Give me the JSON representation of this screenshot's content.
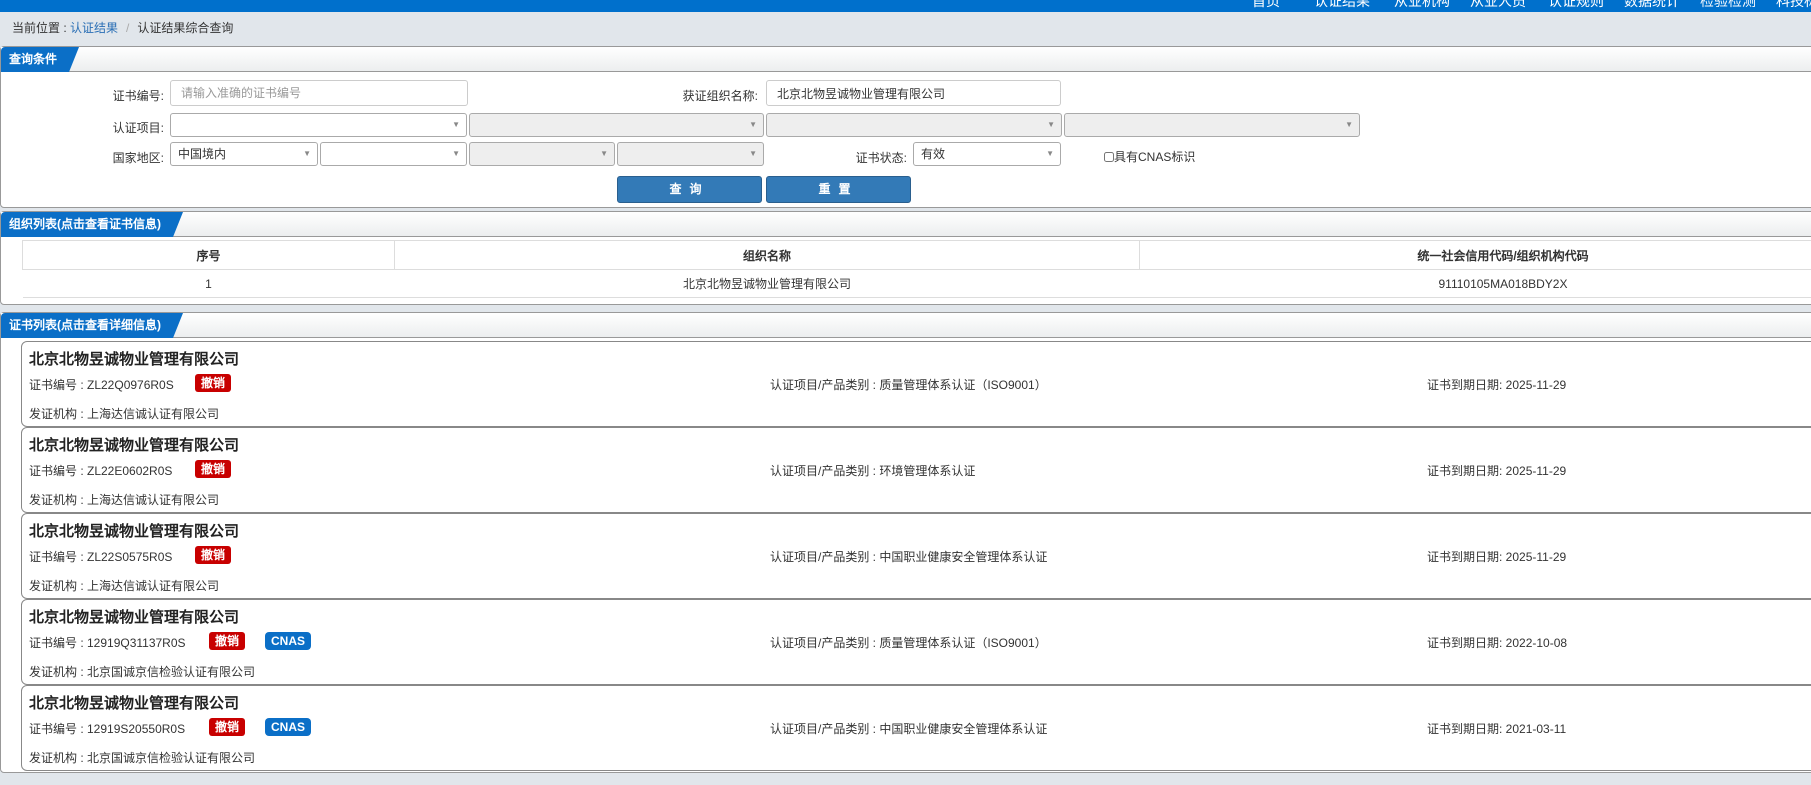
{
  "nav": [
    "首页",
    "认证结果",
    "从业机构",
    "从业人员",
    "认证规则",
    "数据统计",
    "检验检测",
    "科技标准"
  ],
  "breadcrumb": {
    "prefix": "当前位置 : ",
    "link": "认证结果",
    "sep": "/",
    "current": "认证结果综合查询"
  },
  "query": {
    "title": "查询条件",
    "cert_no_label": "证书编号:",
    "cert_no_placeholder": "请输入准确的证书编号",
    "org_label": "获证组织名称:",
    "org_value": "北京北物昱诚物业管理有限公司",
    "item_label": "认证项目:",
    "region_label": "国家地区:",
    "region_value": "中国境内",
    "status_label": "证书状态:",
    "status_value": "有效",
    "cnas_label": "具有CNAS标识",
    "search": "查询",
    "reset": "重置"
  },
  "orgs": {
    "title": "组织列表(点击查看证书信息)",
    "headers": [
      "序号",
      "组织名称",
      "统一社会信用代码/组织机构代码"
    ],
    "rows": [
      [
        "1",
        "北京北物昱诚物业管理有限公司",
        "91110105MA018BDY2X"
      ]
    ]
  },
  "certs": {
    "title": "证书列表(点击查看详细信息)",
    "badge_revoked": "撤销",
    "badge_cnas": "CNAS",
    "items": [
      {
        "org": "北京北物昱诚物业管理有限公司",
        "cert_no": "证书编号 : ZL22Q0976R0S",
        "cnas": false,
        "item": "认证项目/产品类别 : 质量管理体系认证（ISO9001）",
        "issuer": "发证机构 : 上海达信诚认证有限公司",
        "expiry": "证书到期日期: 2025-11-29"
      },
      {
        "org": "北京北物昱诚物业管理有限公司",
        "cert_no": "证书编号 : ZL22E0602R0S",
        "cnas": false,
        "item": "认证项目/产品类别 : 环境管理体系认证",
        "issuer": "发证机构 : 上海达信诚认证有限公司",
        "expiry": "证书到期日期: 2025-11-29"
      },
      {
        "org": "北京北物昱诚物业管理有限公司",
        "cert_no": "证书编号 : ZL22S0575R0S",
        "cnas": false,
        "item": "认证项目/产品类别 : 中国职业健康安全管理体系认证",
        "issuer": "发证机构 : 上海达信诚认证有限公司",
        "expiry": "证书到期日期: 2025-11-29"
      },
      {
        "org": "北京北物昱诚物业管理有限公司",
        "cert_no": "证书编号 : 12919Q31137R0S",
        "cnas": true,
        "item": "认证项目/产品类别 : 质量管理体系认证（ISO9001）",
        "issuer": "发证机构 : 北京国诚京信检验认证有限公司",
        "expiry": "证书到期日期: 2022-10-08"
      },
      {
        "org": "北京北物昱诚物业管理有限公司",
        "cert_no": "证书编号 : 12919S20550R0S",
        "cnas": true,
        "item": "认证项目/产品类别 : 中国职业健康安全管理体系认证",
        "issuer": "发证机构 : 北京国诚京信检验认证有限公司",
        "expiry": "证书到期日期: 2021-03-11"
      }
    ]
  }
}
